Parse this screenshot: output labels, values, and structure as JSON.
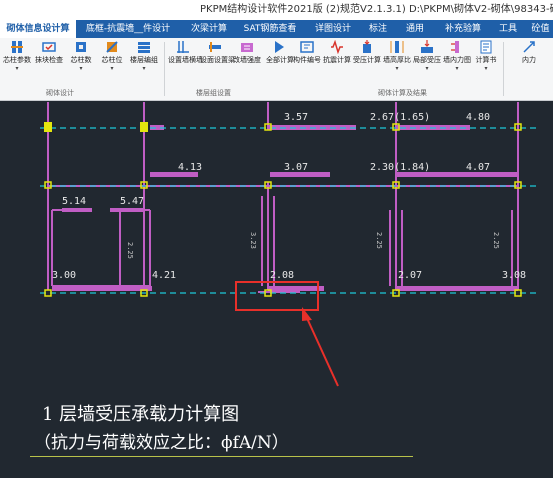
{
  "window": {
    "title": "PKPM结构设计软件2021版 (2)规范V2.1.3.1) D:\\PKPM\\砌体V2-砌体\\98343-砌体结构"
  },
  "tabs": [
    {
      "label": "砌体信息设计算",
      "active": true
    },
    {
      "label": "底框-抗震墙__件设计",
      "active": false
    },
    {
      "label": "次梁计算",
      "active": false
    },
    {
      "label": "SAT钢筋查看",
      "active": false
    },
    {
      "label": "详图设计",
      "active": false
    },
    {
      "label": "标注",
      "active": false
    },
    {
      "label": "通用",
      "active": false
    },
    {
      "label": "补充验算",
      "active": false
    },
    {
      "label": "工具",
      "active": false
    },
    {
      "label": "砼值",
      "active": false
    }
  ],
  "ribbon": {
    "buttons": [
      {
        "label": "芯柱参数",
        "icon": "column-params-icon"
      },
      {
        "label": "抹块检查",
        "icon": "block-check-icon"
      },
      {
        "label": "芯柱数",
        "icon": "column-count-icon"
      },
      {
        "label": "芯柱位",
        "icon": "column-position-icon"
      },
      {
        "label": "楼层编组",
        "icon": "floor-group-icon"
      },
      {
        "label": "设置墙横墙",
        "icon": "set-wall-icon"
      },
      {
        "label": "设面设置梁",
        "icon": "beam-set-icon"
      },
      {
        "label": "改墙强度",
        "icon": "wall-strength-icon"
      },
      {
        "label": "全部计算",
        "icon": "play-icon"
      },
      {
        "label": "构件编号",
        "icon": "member-number-icon"
      },
      {
        "label": "抗震计算",
        "icon": "seismic-calc-icon"
      },
      {
        "label": "受压计算",
        "icon": "compression-calc-icon"
      },
      {
        "label": "墙高厚比",
        "icon": "height-ratio-icon"
      },
      {
        "label": "局部受压",
        "icon": "local-compression-icon"
      },
      {
        "label": "墙内力图",
        "icon": "wall-force-icon"
      },
      {
        "label": "计算书",
        "icon": "report-icon"
      },
      {
        "label": "内力",
        "icon": "force-icon"
      }
    ],
    "groups": [
      "砌体设计",
      "楼层组设置",
      "砌体计算及结果"
    ]
  },
  "drawing": {
    "values": [
      "3.57",
      "2.67(1.65)",
      "4.80",
      "4.13",
      "3.07",
      "2.30(1.84)",
      "4.07",
      "5.14",
      "5.47",
      "3.00",
      "4.21",
      "2.08",
      "2.07",
      "3.08"
    ],
    "side_labels": [
      "2.25",
      "3.23",
      "2.25",
      "2.25"
    ]
  },
  "caption": {
    "line1": "1    层墙受压承载力计算图",
    "line2": "（抗力与荷载效应之比：ϕfA/N）"
  },
  "colors": {
    "background": "#212830",
    "tab_bar": "#1f5fa8",
    "wall": "#c05ec4",
    "axis": "#1ec8d8",
    "column": "#e4e60e",
    "highlight_box": "#e8302a",
    "text_white": "#ffffff"
  }
}
